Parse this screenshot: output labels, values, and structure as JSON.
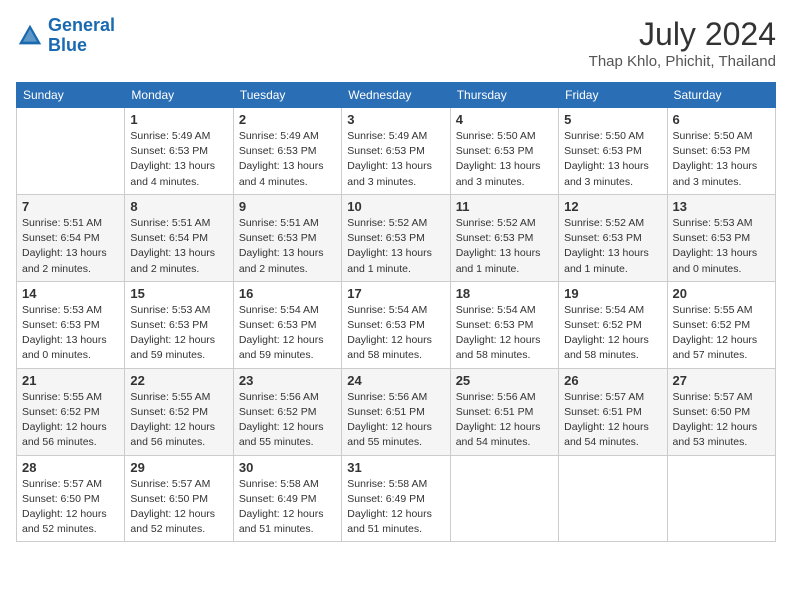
{
  "header": {
    "logo_line1": "General",
    "logo_line2": "Blue",
    "month_year": "July 2024",
    "location": "Thap Khlo, Phichit, Thailand"
  },
  "weekdays": [
    "Sunday",
    "Monday",
    "Tuesday",
    "Wednesday",
    "Thursday",
    "Friday",
    "Saturday"
  ],
  "weeks": [
    [
      {
        "day": "",
        "info": ""
      },
      {
        "day": "1",
        "info": "Sunrise: 5:49 AM\nSunset: 6:53 PM\nDaylight: 13 hours\nand 4 minutes."
      },
      {
        "day": "2",
        "info": "Sunrise: 5:49 AM\nSunset: 6:53 PM\nDaylight: 13 hours\nand 4 minutes."
      },
      {
        "day": "3",
        "info": "Sunrise: 5:49 AM\nSunset: 6:53 PM\nDaylight: 13 hours\nand 3 minutes."
      },
      {
        "day": "4",
        "info": "Sunrise: 5:50 AM\nSunset: 6:53 PM\nDaylight: 13 hours\nand 3 minutes."
      },
      {
        "day": "5",
        "info": "Sunrise: 5:50 AM\nSunset: 6:53 PM\nDaylight: 13 hours\nand 3 minutes."
      },
      {
        "day": "6",
        "info": "Sunrise: 5:50 AM\nSunset: 6:53 PM\nDaylight: 13 hours\nand 3 minutes."
      }
    ],
    [
      {
        "day": "7",
        "info": "Sunrise: 5:51 AM\nSunset: 6:54 PM\nDaylight: 13 hours\nand 2 minutes."
      },
      {
        "day": "8",
        "info": "Sunrise: 5:51 AM\nSunset: 6:54 PM\nDaylight: 13 hours\nand 2 minutes."
      },
      {
        "day": "9",
        "info": "Sunrise: 5:51 AM\nSunset: 6:53 PM\nDaylight: 13 hours\nand 2 minutes."
      },
      {
        "day": "10",
        "info": "Sunrise: 5:52 AM\nSunset: 6:53 PM\nDaylight: 13 hours\nand 1 minute."
      },
      {
        "day": "11",
        "info": "Sunrise: 5:52 AM\nSunset: 6:53 PM\nDaylight: 13 hours\nand 1 minute."
      },
      {
        "day": "12",
        "info": "Sunrise: 5:52 AM\nSunset: 6:53 PM\nDaylight: 13 hours\nand 1 minute."
      },
      {
        "day": "13",
        "info": "Sunrise: 5:53 AM\nSunset: 6:53 PM\nDaylight: 13 hours\nand 0 minutes."
      }
    ],
    [
      {
        "day": "14",
        "info": "Sunrise: 5:53 AM\nSunset: 6:53 PM\nDaylight: 13 hours\nand 0 minutes."
      },
      {
        "day": "15",
        "info": "Sunrise: 5:53 AM\nSunset: 6:53 PM\nDaylight: 12 hours\nand 59 minutes."
      },
      {
        "day": "16",
        "info": "Sunrise: 5:54 AM\nSunset: 6:53 PM\nDaylight: 12 hours\nand 59 minutes."
      },
      {
        "day": "17",
        "info": "Sunrise: 5:54 AM\nSunset: 6:53 PM\nDaylight: 12 hours\nand 58 minutes."
      },
      {
        "day": "18",
        "info": "Sunrise: 5:54 AM\nSunset: 6:53 PM\nDaylight: 12 hours\nand 58 minutes."
      },
      {
        "day": "19",
        "info": "Sunrise: 5:54 AM\nSunset: 6:52 PM\nDaylight: 12 hours\nand 58 minutes."
      },
      {
        "day": "20",
        "info": "Sunrise: 5:55 AM\nSunset: 6:52 PM\nDaylight: 12 hours\nand 57 minutes."
      }
    ],
    [
      {
        "day": "21",
        "info": "Sunrise: 5:55 AM\nSunset: 6:52 PM\nDaylight: 12 hours\nand 56 minutes."
      },
      {
        "day": "22",
        "info": "Sunrise: 5:55 AM\nSunset: 6:52 PM\nDaylight: 12 hours\nand 56 minutes."
      },
      {
        "day": "23",
        "info": "Sunrise: 5:56 AM\nSunset: 6:52 PM\nDaylight: 12 hours\nand 55 minutes."
      },
      {
        "day": "24",
        "info": "Sunrise: 5:56 AM\nSunset: 6:51 PM\nDaylight: 12 hours\nand 55 minutes."
      },
      {
        "day": "25",
        "info": "Sunrise: 5:56 AM\nSunset: 6:51 PM\nDaylight: 12 hours\nand 54 minutes."
      },
      {
        "day": "26",
        "info": "Sunrise: 5:57 AM\nSunset: 6:51 PM\nDaylight: 12 hours\nand 54 minutes."
      },
      {
        "day": "27",
        "info": "Sunrise: 5:57 AM\nSunset: 6:50 PM\nDaylight: 12 hours\nand 53 minutes."
      }
    ],
    [
      {
        "day": "28",
        "info": "Sunrise: 5:57 AM\nSunset: 6:50 PM\nDaylight: 12 hours\nand 52 minutes."
      },
      {
        "day": "29",
        "info": "Sunrise: 5:57 AM\nSunset: 6:50 PM\nDaylight: 12 hours\nand 52 minutes."
      },
      {
        "day": "30",
        "info": "Sunrise: 5:58 AM\nSunset: 6:49 PM\nDaylight: 12 hours\nand 51 minutes."
      },
      {
        "day": "31",
        "info": "Sunrise: 5:58 AM\nSunset: 6:49 PM\nDaylight: 12 hours\nand 51 minutes."
      },
      {
        "day": "",
        "info": ""
      },
      {
        "day": "",
        "info": ""
      },
      {
        "day": "",
        "info": ""
      }
    ]
  ]
}
